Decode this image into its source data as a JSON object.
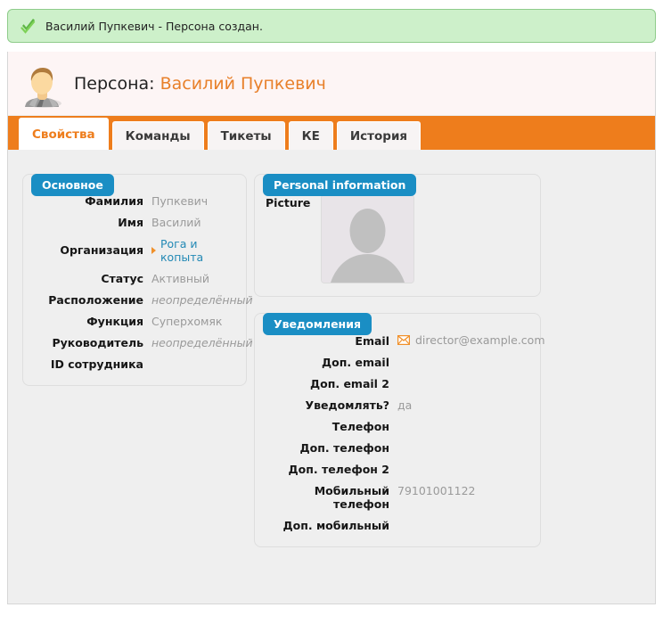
{
  "banner": {
    "icon": "check-icon",
    "message": "Василий Пупкевич - Персона создан."
  },
  "header": {
    "icon": "person-avatar-icon",
    "label": "Персона:",
    "name": "Василий Пупкевич"
  },
  "tabs": [
    {
      "label": "Свойства",
      "active": true
    },
    {
      "label": "Команды",
      "active": false
    },
    {
      "label": "Тикеты",
      "active": false
    },
    {
      "label": "КЕ",
      "active": false
    },
    {
      "label": "История",
      "active": false
    }
  ],
  "panels": {
    "basic": {
      "title": "Основное",
      "fields": [
        {
          "label": "Фамилия",
          "value": "Пупкевич",
          "style": "plain"
        },
        {
          "label": "Имя",
          "value": "Василий",
          "style": "plain"
        },
        {
          "label": "Организация",
          "value": "Рога и копыта",
          "style": "link"
        },
        {
          "label": "Статус",
          "value": "Активный",
          "style": "plain"
        },
        {
          "label": "Расположение",
          "value": "неопределённый",
          "style": "italic"
        },
        {
          "label": "Функция",
          "value": "Суперхомяк",
          "style": "plain"
        },
        {
          "label": "Руководитель",
          "value": "неопределённый",
          "style": "italic"
        },
        {
          "label": "ID сотрудника",
          "value": "",
          "style": "plain"
        }
      ]
    },
    "personal": {
      "title": "Personal information",
      "picture_label": "Picture",
      "picture_icon": "avatar-placeholder-icon"
    },
    "notifications": {
      "title": "Уведомления",
      "fields": [
        {
          "label": "Email",
          "value": "director@example.com",
          "style": "mail"
        },
        {
          "label": "Доп. email",
          "value": "",
          "style": "plain"
        },
        {
          "label": "Доп. email 2",
          "value": "",
          "style": "plain"
        },
        {
          "label": "Уведомлять?",
          "value": "да",
          "style": "plain"
        },
        {
          "label": "Телефон",
          "value": "",
          "style": "plain"
        },
        {
          "label": "Доп. телефон",
          "value": "",
          "style": "plain"
        },
        {
          "label": "Доп. телефон 2",
          "value": "",
          "style": "plain"
        },
        {
          "label": "Мобильный телефон",
          "value": "79101001122",
          "style": "plain"
        },
        {
          "label": "Доп. мобильный",
          "value": "",
          "style": "plain"
        }
      ]
    }
  },
  "colors": {
    "accent_orange": "#ee7d1c",
    "badge_blue": "#1a8ec4",
    "link_blue": "#2389b5",
    "success_green": "#cdf0ca",
    "value_gray": "#9a9a9a"
  }
}
